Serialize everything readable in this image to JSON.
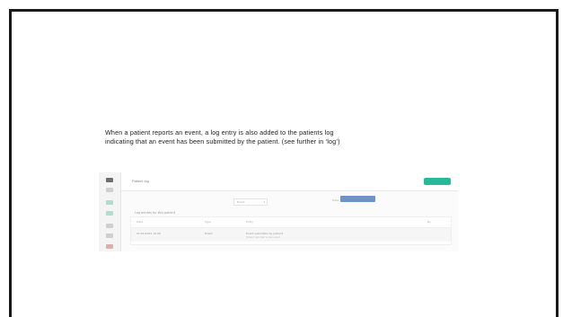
{
  "caption": {
    "line1": "When a patient reports an event, a log entry is also added to the patients log",
    "line2": "indicating that an event has been submitted by the patient. (see further in ‘log’)"
  },
  "app": {
    "title": "Patient log",
    "primary_button_label": "",
    "filter_select": {
      "value": "Event",
      "caret": "▾"
    },
    "date_label": "Date",
    "filter_button_label": "",
    "section_title": "Log entries for this patient",
    "table": {
      "headers": [
        "Date",
        "Type",
        "Entry",
        "By"
      ],
      "rows": [
        {
          "date": "01/01/2021 10:00",
          "type": "Event",
          "entry": "Event submitted by patient",
          "entry_detail": "Patient reported a new event",
          "by": ""
        }
      ]
    }
  },
  "colors": {
    "accent": "#2bb89a",
    "filter_button": "#6f93c9",
    "sidebar_icons": [
      "#6e6e6e",
      "#b4dccd",
      "#b4dccd",
      "#cfcfcf",
      "#d9b0b0"
    ]
  }
}
